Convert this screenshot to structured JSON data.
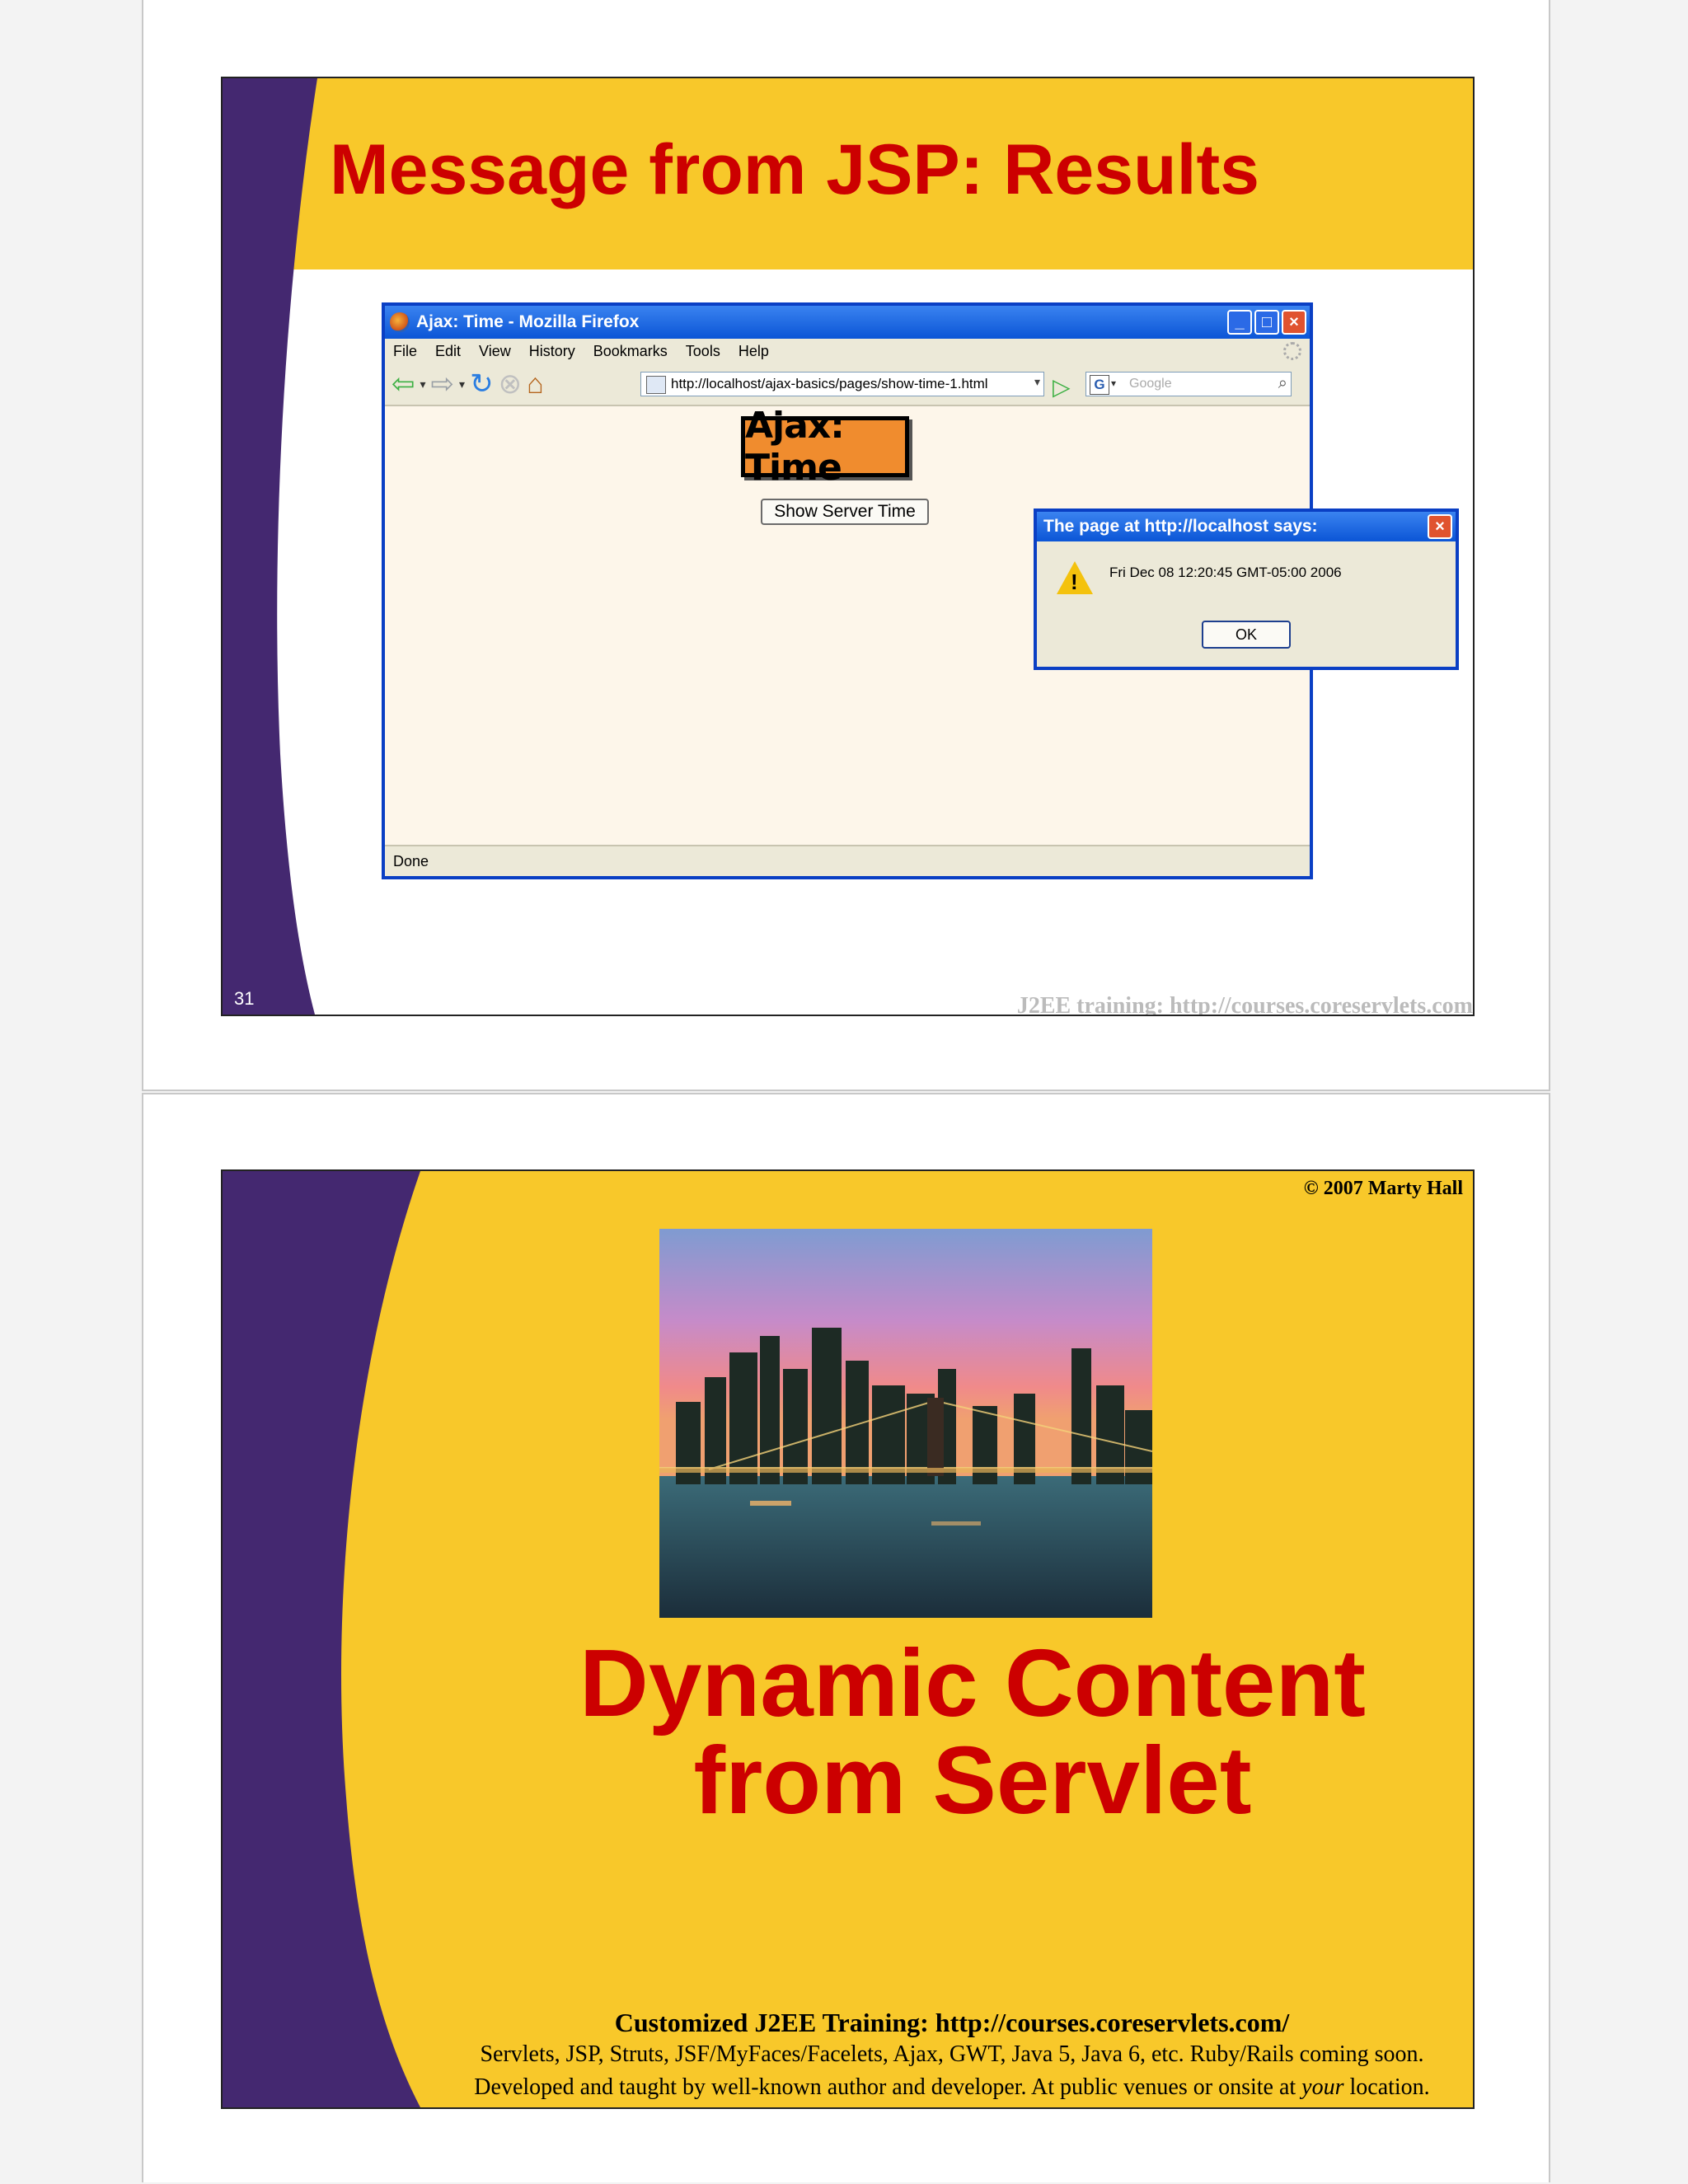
{
  "slide1": {
    "title": "Message from JSP: Results",
    "page_number": "31",
    "footer": "J2EE training: http://courses.coreservlets.com",
    "browser": {
      "window_title": "Ajax: Time - Mozilla Firefox",
      "menu": [
        "File",
        "Edit",
        "View",
        "History",
        "Bookmarks",
        "Tools",
        "Help"
      ],
      "url": "http://localhost/ajax-basics/pages/show-time-1.html",
      "search_placeholder": "Google",
      "page_heading": "Ajax: Time",
      "button_label": "Show Server Time",
      "status": "Done"
    },
    "alert": {
      "title": "The page at http://localhost says:",
      "message": "Fri Dec 08 12:20:45 GMT-05:00 2006",
      "ok_label": "OK"
    }
  },
  "slide2": {
    "copyright": "© 2007 Marty Hall",
    "title_line1": "Dynamic Content",
    "title_line2": "from Servlet",
    "footer_title": "Customized J2EE Training: http://courses.coreservlets.com/",
    "footer_line1": "Servlets, JSP, Struts, JSF/MyFaces/Facelets, Ajax, GWT, Java 5, Java 6, etc. Ruby/Rails coming soon.",
    "footer_line2_before": "Developed and taught by well-known author and developer. At public venues or onsite at ",
    "footer_line2_em": "your",
    "footer_line2_after": " location."
  },
  "colors": {
    "slide_yellow": "#f8c82a",
    "slide_purple": "#442870",
    "title_red": "#cc0000",
    "xp_blue": "#0a3fc4"
  }
}
